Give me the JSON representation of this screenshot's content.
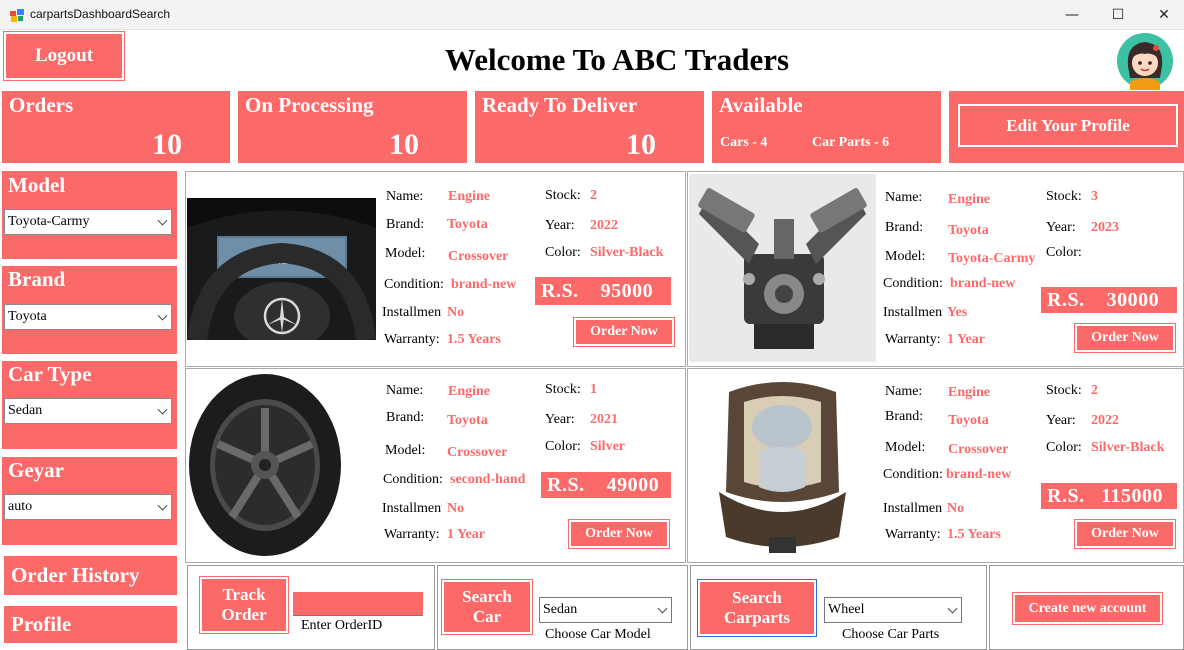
{
  "window": {
    "title": "carpartsDashboardSearch",
    "minimize": "—",
    "maximize": "☐",
    "close": "✕"
  },
  "header": {
    "logout": "Logout",
    "welcome": "Welcome To ABC Traders"
  },
  "stats": {
    "orders": {
      "title": "Orders",
      "value": "10"
    },
    "processing": {
      "title": "On Processing",
      "value": "10"
    },
    "ready": {
      "title": "Ready To Deliver",
      "value": "10"
    },
    "available": {
      "title": "Available",
      "cars": "Cars - 4",
      "parts": "Car Parts - 6"
    },
    "edit_profile": "Edit Your Profile"
  },
  "filters": {
    "model": {
      "label": "Model",
      "value": "Toyota-Carmy"
    },
    "brand": {
      "label": "Brand",
      "value": "Toyota"
    },
    "car_type": {
      "label": "Car Type",
      "value": "Sedan"
    },
    "gear": {
      "label": "Geyar",
      "value": "auto"
    },
    "order_history": "Order History",
    "profile": "Profile"
  },
  "field_labels": {
    "name": "Name:",
    "brand": "Brand:",
    "model": "Model:",
    "condition": "Condition:",
    "installment": "Installment",
    "warranty": "Warranty:",
    "stock": "Stock:",
    "year": "Year:",
    "color": "Color:",
    "order_now": "Order Now"
  },
  "products": [
    {
      "image": "steering-wheel",
      "name": "Engine",
      "brand": "Toyota",
      "model": "Crossover",
      "condition": "brand-new",
      "installment": "No",
      "warranty": "1.5 Years",
      "stock": "2",
      "year": "2022",
      "color": "Silver-Black",
      "price": "R.S.    95000"
    },
    {
      "image": "engine",
      "name": "Engine",
      "brand": "Toyota",
      "model": "Toyota-Carmy",
      "condition": "brand-new",
      "installment": "Yes",
      "warranty": "1 Year",
      "stock": "3",
      "year": "2023",
      "color": "",
      "price": "R.S.    30000"
    },
    {
      "image": "wheel-tire",
      "name": "Engine",
      "brand": "Toyota",
      "model": "Crossover",
      "condition": "second-hand",
      "installment": "No",
      "warranty": "1 Year",
      "stock": "1",
      "year": "2021",
      "color": "Silver",
      "price": "R.S.    49000"
    },
    {
      "image": "car-seat",
      "name": "Engine",
      "brand": "Toyota",
      "model": "Crossover",
      "condition": "brand-new",
      "installment": "No",
      "warranty": "1.5 Years",
      "stock": "2",
      "year": "2022",
      "color": "Silver-Black",
      "price": "R.S.   115000"
    }
  ],
  "bottom": {
    "track_order": "Track Order",
    "order_id_caption": "Enter OrderID",
    "order_id_value": "",
    "search_car": "Search Car",
    "car_model_value": "Sedan",
    "car_model_caption": "Choose Car Model",
    "search_carparts": "Search Carparts",
    "car_parts_value": "Wheel",
    "car_parts_caption": "Choose Car Parts",
    "create_account": "Create new account"
  },
  "colors": {
    "accent": "#fb6969",
    "background": "#ffffff"
  }
}
